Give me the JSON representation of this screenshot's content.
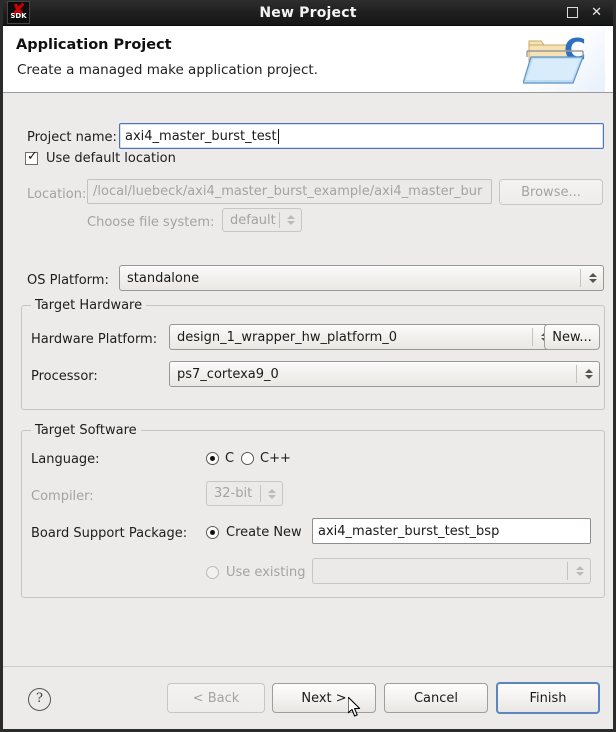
{
  "window": {
    "title": "New Project",
    "logo_text": "SDK",
    "controls": {
      "maximize": "maximize-icon",
      "close": "✕"
    }
  },
  "header": {
    "title": "Application Project",
    "description": "Create a managed make application project.",
    "icon": "c-project-folder-icon"
  },
  "form": {
    "project_name_label": "Project name:",
    "project_name_value": "axi4_master_burst_test",
    "use_default_location_label": "Use default location",
    "use_default_location_checked": true,
    "location_label": "Location:",
    "location_value": "/local/luebeck/axi4_master_burst_example/axi4_master_bur",
    "browse_label": "Browse...",
    "choose_fs_label": "Choose file system:",
    "choose_fs_value": "default",
    "os_platform_label": "OS Platform:",
    "os_platform_value": "standalone"
  },
  "target_hardware": {
    "group_title": "Target Hardware",
    "hardware_platform_label": "Hardware Platform:",
    "hardware_platform_value": "design_1_wrapper_hw_platform_0",
    "new_button_label": "New...",
    "processor_label": "Processor:",
    "processor_value": "ps7_cortexa9_0"
  },
  "target_software": {
    "group_title": "Target Software",
    "language_label": "Language:",
    "language_c_label": "C",
    "language_cpp_label": "C++",
    "language_selected": "C",
    "compiler_label": "Compiler:",
    "compiler_value": "32-bit",
    "bsp_label": "Board Support Package:",
    "bsp_create_new_label": "Create New",
    "bsp_create_new_value": "axi4_master_burst_test_bsp",
    "bsp_use_existing_label": "Use existing",
    "bsp_use_existing_value": "",
    "bsp_selected": "Create New"
  },
  "footer": {
    "help_label": "?",
    "back_label": "< Back",
    "next_label": "Next >",
    "cancel_label": "Cancel",
    "finish_label": "Finish"
  },
  "colors": {
    "dialog_bg": "#edebe9",
    "titlebar_bg": "#1e1e1e",
    "focus_blue": "#4a76b8",
    "default_button_blue": "#5a86c0",
    "logo_red": "#cc0000"
  }
}
